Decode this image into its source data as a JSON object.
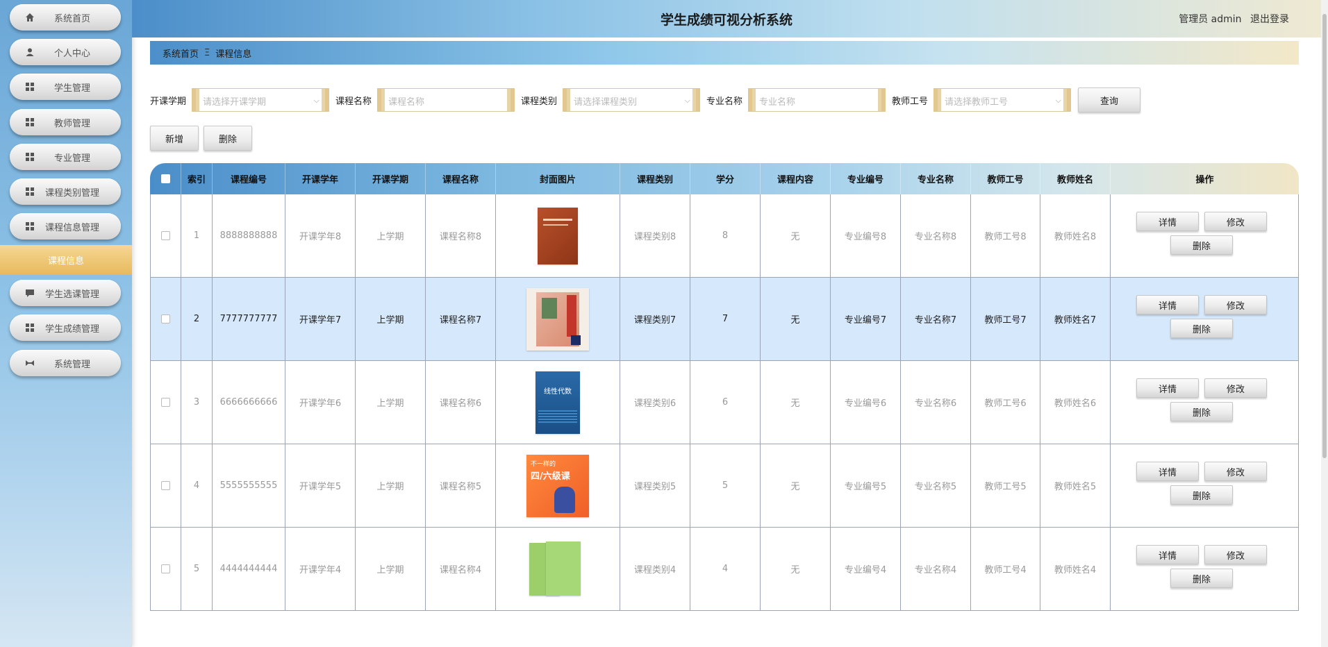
{
  "app": {
    "title": "学生成绩可视分析系统",
    "role": "管理员 admin",
    "logout": "退出登录"
  },
  "sidebar": {
    "items": [
      {
        "label": "系统首页",
        "icon": "home-icon"
      },
      {
        "label": "个人中心",
        "icon": "user-icon"
      },
      {
        "label": "学生管理",
        "icon": "grid-icon"
      },
      {
        "label": "教师管理",
        "icon": "grid-icon"
      },
      {
        "label": "专业管理",
        "icon": "grid-icon"
      },
      {
        "label": "课程类别管理",
        "icon": "grid-icon"
      },
      {
        "label": "课程信息管理",
        "icon": "grid-icon"
      },
      {
        "label": "学生选课管理",
        "icon": "chat-icon"
      },
      {
        "label": "学生成绩管理",
        "icon": "grid-icon"
      },
      {
        "label": "系统管理",
        "icon": "tools-icon"
      }
    ],
    "active_sub": "课程信息"
  },
  "breadcrumb": {
    "home": "系统首页",
    "sep": "Ξ",
    "current": "课程信息"
  },
  "search": {
    "term_label": "开课学期",
    "term_placeholder": "请选择开课学期",
    "course_label": "课程名称",
    "course_placeholder": "课程名称",
    "type_label": "课程类别",
    "type_placeholder": "请选择课程类别",
    "major_label": "专业名称",
    "major_placeholder": "专业名称",
    "teacher_label": "教师工号",
    "teacher_placeholder": "请选择教师工号",
    "query": "查询"
  },
  "toolbar": {
    "add": "新增",
    "delete": "删除"
  },
  "table": {
    "headers": [
      "索引",
      "课程编号",
      "开课学年",
      "开课学期",
      "课程名称",
      "封面图片",
      "课程类别",
      "学分",
      "课程内容",
      "专业编号",
      "专业名称",
      "教师工号",
      "教师姓名",
      "操作"
    ],
    "actions": {
      "detail": "详情",
      "edit": "修改",
      "delete": "删除"
    },
    "rows": [
      {
        "idx": "1",
        "code": "8888888888",
        "year": "开课学年8",
        "term": "上学期",
        "name": "课程名称8",
        "cover": "cover-textbook-red",
        "type": "课程类别8",
        "credit": "8",
        "content": "无",
        "major_no": "专业编号8",
        "major": "专业名称8",
        "tno": "教师工号8",
        "tname": "教师姓名8"
      },
      {
        "idx": "2",
        "code": "7777777777",
        "year": "开课学年7",
        "term": "上学期",
        "name": "课程名称7",
        "cover": "cover-english-book",
        "type": "课程类别7",
        "credit": "7",
        "content": "无",
        "major_no": "专业编号7",
        "major": "专业名称7",
        "tno": "教师工号7",
        "tname": "教师姓名7"
      },
      {
        "idx": "3",
        "code": "6666666666",
        "year": "开课学年6",
        "term": "上学期",
        "name": "课程名称6",
        "cover": "cover-linear-algebra",
        "type": "课程类别6",
        "credit": "6",
        "content": "无",
        "major_no": "专业编号6",
        "major": "专业名称6",
        "tno": "教师工号6",
        "tname": "教师姓名6"
      },
      {
        "idx": "4",
        "code": "5555555555",
        "year": "开课学年5",
        "term": "上学期",
        "name": "课程名称5",
        "cover": "cover-cet-orange",
        "type": "课程类别5",
        "credit": "5",
        "content": "无",
        "major_no": "专业编号5",
        "major": "专业名称5",
        "tno": "教师工号5",
        "tname": "教师姓名5"
      },
      {
        "idx": "5",
        "code": "4444444444",
        "year": "开课学年4",
        "term": "上学期",
        "name": "课程名称4",
        "cover": "cover-green-books",
        "type": "课程类别4",
        "credit": "4",
        "content": "无",
        "major_no": "专业编号4",
        "major": "专业名称4",
        "tno": "教师工号4",
        "tname": "教师姓名4"
      }
    ]
  },
  "cover_texts": {
    "linear": "线性代数",
    "cet_top": "不一样的",
    "cet_main": "四/六级课"
  },
  "colors": {
    "accent_gold": "#e7b95c",
    "header_blue": "#4a8ec9",
    "highlight_row": "#d6e8fb"
  }
}
